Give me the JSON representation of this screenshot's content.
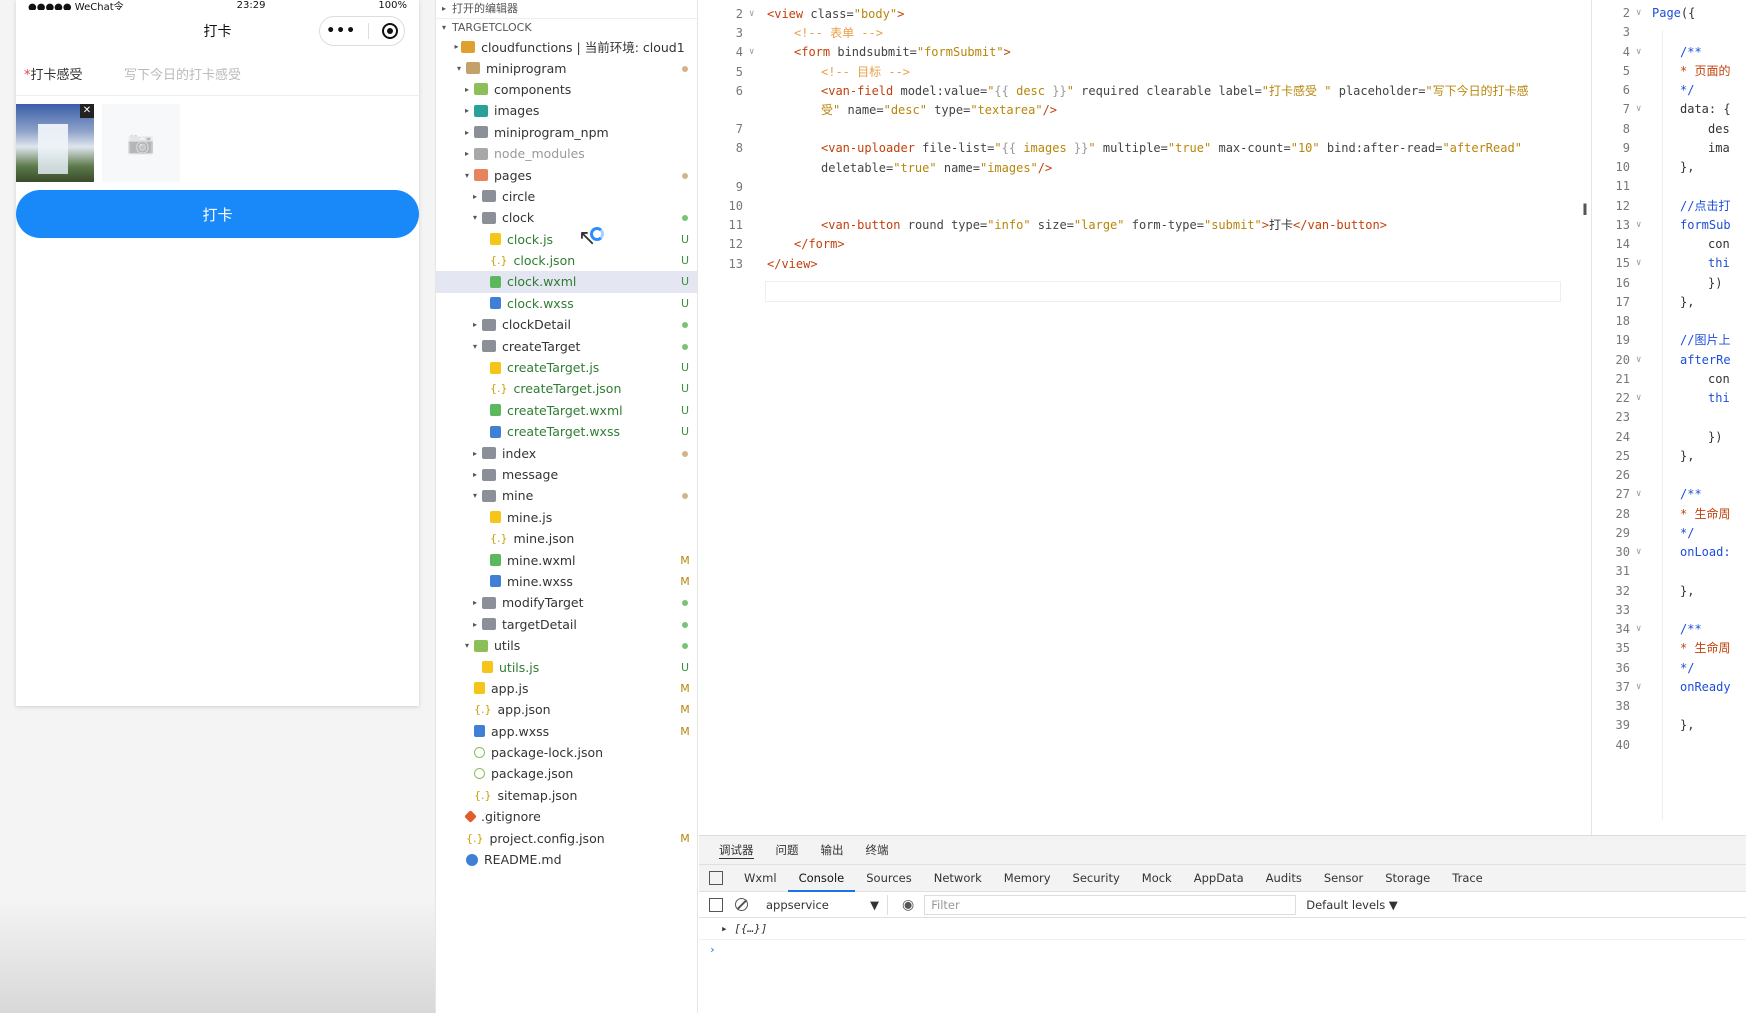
{
  "phone": {
    "status_left": "●●●●● WeChat令",
    "status_time": "23:29",
    "status_battery": "100%",
    "nav_title": "打卡",
    "capsule_dots": "•••",
    "field_required": "*",
    "field_label": "打卡感受",
    "field_placeholder": "写下今日的打卡感受",
    "delete_glyph": "✕",
    "camera_glyph": "📷",
    "submit_label": "打卡"
  },
  "explorer": {
    "open_editors": "打开的编辑器",
    "project": "TARGETCLOCK",
    "items": [
      {
        "name": "cloudfunctions | 当前环境: cloud1",
        "depth": 1,
        "arrow": "▸",
        "icon": "folder-orange",
        "badge": "",
        "style": ""
      },
      {
        "name": "miniprogram",
        "depth": 1,
        "arrow": "▾",
        "icon": "folder-open",
        "badge": "dot-brown",
        "style": ""
      },
      {
        "name": "components",
        "depth": 2,
        "arrow": "▸",
        "icon": "folder-green",
        "badge": "",
        "style": ""
      },
      {
        "name": "images",
        "depth": 2,
        "arrow": "▸",
        "icon": "folder-teal",
        "badge": "",
        "style": ""
      },
      {
        "name": "miniprogram_npm",
        "depth": 2,
        "arrow": "▸",
        "icon": "folder",
        "badge": "",
        "style": ""
      },
      {
        "name": "node_modules",
        "depth": 2,
        "arrow": "▸",
        "icon": "folder-gray",
        "badge": "",
        "style": "gray"
      },
      {
        "name": "pages",
        "depth": 2,
        "arrow": "▾",
        "icon": "folder-red",
        "badge": "dot-brown",
        "style": ""
      },
      {
        "name": "circle",
        "depth": 3,
        "arrow": "▸",
        "icon": "folder",
        "badge": "",
        "style": ""
      },
      {
        "name": "clock",
        "depth": 3,
        "arrow": "▾",
        "icon": "folder",
        "badge": "dot-green",
        "style": ""
      },
      {
        "name": "clock.js",
        "depth": 4,
        "arrow": "",
        "icon": "js",
        "badge": "U",
        "style": "green"
      },
      {
        "name": "clock.json",
        "depth": 4,
        "arrow": "",
        "icon": "json",
        "badge": "U",
        "style": "green"
      },
      {
        "name": "clock.wxml",
        "depth": 4,
        "arrow": "",
        "icon": "wxml",
        "badge": "U",
        "style": "green",
        "selected": true
      },
      {
        "name": "clock.wxss",
        "depth": 4,
        "arrow": "",
        "icon": "wxss",
        "badge": "U",
        "style": "green"
      },
      {
        "name": "clockDetail",
        "depth": 3,
        "arrow": "▸",
        "icon": "folder",
        "badge": "dot-green",
        "style": ""
      },
      {
        "name": "createTarget",
        "depth": 3,
        "arrow": "▾",
        "icon": "folder",
        "badge": "dot-green",
        "style": ""
      },
      {
        "name": "createTarget.js",
        "depth": 4,
        "arrow": "",
        "icon": "js",
        "badge": "U",
        "style": "green"
      },
      {
        "name": "createTarget.json",
        "depth": 4,
        "arrow": "",
        "icon": "json",
        "badge": "U",
        "style": "green"
      },
      {
        "name": "createTarget.wxml",
        "depth": 4,
        "arrow": "",
        "icon": "wxml",
        "badge": "U",
        "style": "green"
      },
      {
        "name": "createTarget.wxss",
        "depth": 4,
        "arrow": "",
        "icon": "wxss",
        "badge": "U",
        "style": "green"
      },
      {
        "name": "index",
        "depth": 3,
        "arrow": "▸",
        "icon": "folder",
        "badge": "dot-brown",
        "style": ""
      },
      {
        "name": "message",
        "depth": 3,
        "arrow": "▸",
        "icon": "folder",
        "badge": "",
        "style": ""
      },
      {
        "name": "mine",
        "depth": 3,
        "arrow": "▾",
        "icon": "folder",
        "badge": "dot-brown",
        "style": ""
      },
      {
        "name": "mine.js",
        "depth": 4,
        "arrow": "",
        "icon": "js",
        "badge": "",
        "style": ""
      },
      {
        "name": "mine.json",
        "depth": 4,
        "arrow": "",
        "icon": "json",
        "badge": "",
        "style": ""
      },
      {
        "name": "mine.wxml",
        "depth": 4,
        "arrow": "",
        "icon": "wxml",
        "badge": "M",
        "style": ""
      },
      {
        "name": "mine.wxss",
        "depth": 4,
        "arrow": "",
        "icon": "wxss",
        "badge": "M",
        "style": ""
      },
      {
        "name": "modifyTarget",
        "depth": 3,
        "arrow": "▸",
        "icon": "folder",
        "badge": "dot-green",
        "style": ""
      },
      {
        "name": "targetDetail",
        "depth": 3,
        "arrow": "▸",
        "icon": "folder",
        "badge": "dot-green",
        "style": ""
      },
      {
        "name": "utils",
        "depth": 2,
        "arrow": "▾",
        "icon": "folder-green",
        "badge": "dot-green",
        "style": ""
      },
      {
        "name": "utils.js",
        "depth": 3,
        "arrow": "",
        "icon": "js",
        "badge": "U",
        "style": "green"
      },
      {
        "name": "app.js",
        "depth": 2,
        "arrow": "",
        "icon": "js",
        "badge": "M",
        "style": ""
      },
      {
        "name": "app.json",
        "depth": 2,
        "arrow": "",
        "icon": "json",
        "badge": "M",
        "style": ""
      },
      {
        "name": "app.wxss",
        "depth": 2,
        "arrow": "",
        "icon": "wxss",
        "badge": "M",
        "style": ""
      },
      {
        "name": "package-lock.json",
        "depth": 2,
        "arrow": "",
        "icon": "pkg",
        "badge": "",
        "style": ""
      },
      {
        "name": "package.json",
        "depth": 2,
        "arrow": "",
        "icon": "pkg",
        "badge": "",
        "style": ""
      },
      {
        "name": "sitemap.json",
        "depth": 2,
        "arrow": "",
        "icon": "json",
        "badge": "",
        "style": ""
      },
      {
        "name": ".gitignore",
        "depth": 1,
        "arrow": "",
        "icon": "git",
        "badge": "",
        "style": ""
      },
      {
        "name": "project.config.json",
        "depth": 1,
        "arrow": "",
        "icon": "json",
        "badge": "M",
        "style": ""
      },
      {
        "name": "README.md",
        "depth": 1,
        "arrow": "",
        "icon": "info",
        "badge": "",
        "style": ""
      }
    ]
  },
  "editor": {
    "lines": [
      {
        "n": "2",
        "fold": "∨",
        "html": "<span class='tag'>&lt;view</span> <span class='attr'>class=</span><span class='str'>\"body\"</span><span class='tag'>&gt;</span>",
        "indent": 0
      },
      {
        "n": "3",
        "fold": "",
        "html": "<span class='cmt'>&lt;!-- 表单 --&gt;</span>",
        "indent": 1
      },
      {
        "n": "4",
        "fold": "∨",
        "html": "<span class='tag'>&lt;form</span> <span class='attr'>bindsubmit=</span><span class='str'>\"formSubmit\"</span><span class='tag'>&gt;</span>",
        "indent": 1
      },
      {
        "n": "5",
        "fold": "",
        "html": "<span class='cmt'>&lt;!-- 目标 --&gt;</span>",
        "indent": 2
      },
      {
        "n": "6",
        "fold": "",
        "html": "<span class='tag'>&lt;van-field</span> <span class='attr'>model:value=</span><span class='str'>\"</span><span class='interp'>{{</span> <span class='str'>desc</span> <span class='interp'>}}</span><span class='str'>\"</span> <span class='attr'>required clearable label=</span><span class='str'>\"打卡感受 \"</span> <span class='attr'>placeholder=</span><span class='str'>\"写下今日的打卡感</span>",
        "indent": 2
      },
      {
        "n": "",
        "fold": "",
        "html": "<span class='str'>受\"</span> <span class='attr'>name=</span><span class='str'>\"desc\"</span> <span class='attr'>type=</span><span class='str'>\"textarea\"</span><span class='tag'>/&gt;</span>",
        "indent": 2
      },
      {
        "n": "7",
        "fold": "",
        "html": "",
        "indent": 0
      },
      {
        "n": "8",
        "fold": "",
        "html": "<span class='tag'>&lt;van-uploader</span> <span class='attr'>file-list=</span><span class='str'>\"</span><span class='interp'>{{</span> <span class='str'>images</span> <span class='interp'>}}</span><span class='str'>\"</span> <span class='attr'>multiple=</span><span class='str'>\"true\"</span>  <span class='attr'>max-count=</span><span class='str'>\"10\"</span> <span class='attr'>bind:after-read=</span><span class='str'>\"afterRead\"</span>",
        "indent": 2
      },
      {
        "n": "",
        "fold": "",
        "html": "<span class='attr'>deletable=</span><span class='str'>\"true\"</span> <span class='attr'>name=</span><span class='str'>\"images\"</span><span class='tag'>/&gt;</span>",
        "indent": 2
      },
      {
        "n": "9",
        "fold": "",
        "html": "",
        "indent": 0
      },
      {
        "n": "10",
        "fold": "",
        "html": "",
        "indent": 0
      },
      {
        "n": "11",
        "fold": "",
        "html": "<span class='tag'>&lt;van-button</span> <span class='attr'>round type=</span><span class='str'>\"info\"</span> <span class='attr'>size=</span><span class='str'>\"large\"</span> <span class='attr'>form-type=</span><span class='str'>\"submit\"</span><span class='tag'>&gt;</span><span class='zh'>打卡</span><span class='tag'>&lt;/van-button&gt;</span>",
        "indent": 2
      },
      {
        "n": "12",
        "fold": "",
        "html": "<span class='tag'>&lt;/form&gt;</span>",
        "indent": 1
      },
      {
        "n": "13",
        "fold": "",
        "html": "<span class='tag'>&lt;/view&gt;</span>",
        "indent": 0
      }
    ]
  },
  "editor2": {
    "lines": [
      {
        "n": "2",
        "fold": "∨",
        "html": "<span class='kw'>Page</span>({",
        "indent": 0
      },
      {
        "n": "3",
        "fold": "",
        "html": "",
        "indent": 0
      },
      {
        "n": "4",
        "fold": "∨",
        "html": "<span class='kw'>/**</span>",
        "indent": 1
      },
      {
        "n": "5",
        "fold": "",
        "html": "<span class='cm'>* 页面的</span>",
        "indent": 1
      },
      {
        "n": "6",
        "fold": "",
        "html": "<span class='kw'>*/</span>",
        "indent": 1
      },
      {
        "n": "7",
        "fold": "∨",
        "html": "data: {",
        "indent": 1
      },
      {
        "n": "8",
        "fold": "",
        "html": "des",
        "indent": 2
      },
      {
        "n": "9",
        "fold": "",
        "html": "ima",
        "indent": 2
      },
      {
        "n": "10",
        "fold": "",
        "html": "},",
        "indent": 1
      },
      {
        "n": "11",
        "fold": "",
        "html": "",
        "indent": 0
      },
      {
        "n": "12",
        "fold": "",
        "html": "<span class='kw'>//点击打</span>",
        "indent": 1
      },
      {
        "n": "13",
        "fold": "∨",
        "html": "<span class='kw'>formSub</span>",
        "indent": 1
      },
      {
        "n": "14",
        "fold": "",
        "html": "con",
        "indent": 2
      },
      {
        "n": "15",
        "fold": "∨",
        "html": "<span class='kw'>thi</span>",
        "indent": 2
      },
      {
        "n": "16",
        "fold": "",
        "html": "})",
        "indent": 2
      },
      {
        "n": "17",
        "fold": "",
        "html": "},",
        "indent": 1
      },
      {
        "n": "18",
        "fold": "",
        "html": "",
        "indent": 0
      },
      {
        "n": "19",
        "fold": "",
        "html": "<span class='kw'>//图片上</span>",
        "indent": 1
      },
      {
        "n": "20",
        "fold": "∨",
        "html": "<span class='kw'>afterRe</span>",
        "indent": 1
      },
      {
        "n": "21",
        "fold": "",
        "html": "con",
        "indent": 2
      },
      {
        "n": "22",
        "fold": "∨",
        "html": "<span class='kw'>thi</span>",
        "indent": 2
      },
      {
        "n": "23",
        "fold": "",
        "html": "",
        "indent": 0
      },
      {
        "n": "24",
        "fold": "",
        "html": "})",
        "indent": 2
      },
      {
        "n": "25",
        "fold": "",
        "html": "},",
        "indent": 1
      },
      {
        "n": "26",
        "fold": "",
        "html": "",
        "indent": 0
      },
      {
        "n": "27",
        "fold": "∨",
        "html": "<span class='kw'>/**</span>",
        "indent": 1
      },
      {
        "n": "28",
        "fold": "",
        "html": "<span class='cm'>* 生命周</span>",
        "indent": 1
      },
      {
        "n": "29",
        "fold": "",
        "html": "<span class='kw'>*/</span>",
        "indent": 1
      },
      {
        "n": "30",
        "fold": "∨",
        "html": "<span class='kw'>onLoad:</span>",
        "indent": 1
      },
      {
        "n": "31",
        "fold": "",
        "html": "",
        "indent": 0
      },
      {
        "n": "32",
        "fold": "",
        "html": "},",
        "indent": 1
      },
      {
        "n": "33",
        "fold": "",
        "html": "",
        "indent": 0
      },
      {
        "n": "34",
        "fold": "∨",
        "html": "<span class='kw'>/**</span>",
        "indent": 1
      },
      {
        "n": "35",
        "fold": "",
        "html": "<span class='cm'>* 生命周</span>",
        "indent": 1
      },
      {
        "n": "36",
        "fold": "",
        "html": "<span class='kw'>*/</span>",
        "indent": 1
      },
      {
        "n": "37",
        "fold": "∨",
        "html": "<span class='kw'>onReady</span>",
        "indent": 1
      },
      {
        "n": "38",
        "fold": "",
        "html": "",
        "indent": 0
      },
      {
        "n": "39",
        "fold": "",
        "html": "},",
        "indent": 1
      },
      {
        "n": "40",
        "fold": "",
        "html": "",
        "indent": 0
      }
    ]
  },
  "debugger": {
    "top_tabs": [
      "调试器",
      "问题",
      "输出",
      "终端"
    ],
    "panel_tabs": [
      "Wxml",
      "Console",
      "Sources",
      "Network",
      "Memory",
      "Security",
      "Mock",
      "AppData",
      "Audits",
      "Sensor",
      "Storage",
      "Trace"
    ],
    "active_panel": "Console",
    "context": "appservice",
    "filter_placeholder": "Filter",
    "levels": "Default levels ▼",
    "console_entry": "▸ [{…}]",
    "prompt": "›"
  },
  "colors": {
    "accent": "#1989fa",
    "tab_active": "#1a73e8",
    "untracked": "#3c8f3c",
    "modified": "#b8860b"
  }
}
